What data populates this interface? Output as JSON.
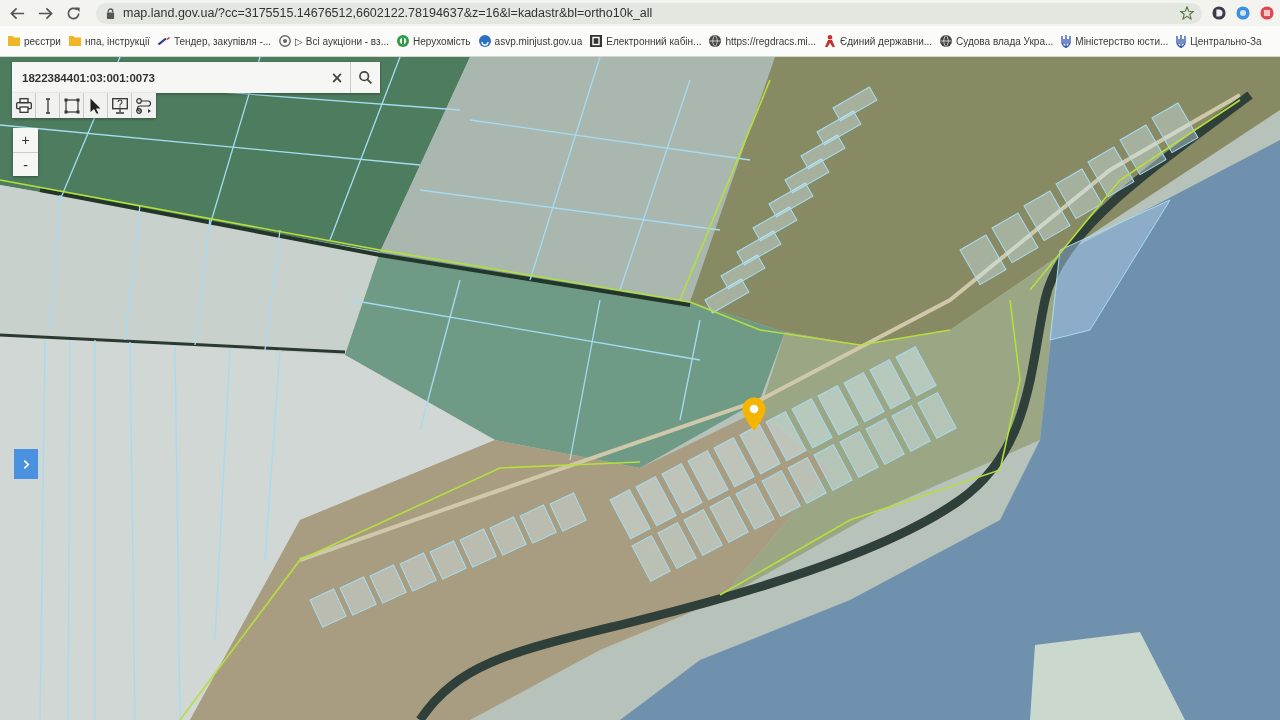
{
  "browser": {
    "url": "map.land.gov.ua/?cc=3175515.14676512,6602122.78194637&z=16&l=kadastr&bl=ortho10k_all"
  },
  "bookmarks": [
    {
      "kind": "folder",
      "label": "реєстри"
    },
    {
      "kind": "folder",
      "label": "нпа, інструкції"
    },
    {
      "kind": "pen",
      "label": "Тендер, закупівля -..."
    },
    {
      "kind": "ring",
      "label": "▷ Всі аукціони - вз..."
    },
    {
      "kind": "emblem",
      "label": "Нерухомість"
    },
    {
      "kind": "disc",
      "label": "asvp.minjust.gov.ua"
    },
    {
      "kind": "tile",
      "label": "Електронний кабін..."
    },
    {
      "kind": "globe",
      "label": "https://regdracs.mi..."
    },
    {
      "kind": "person",
      "label": "Єдиний державни..."
    },
    {
      "kind": "globe",
      "label": "Судова влада Укра..."
    },
    {
      "kind": "trident",
      "label": "Міністерство юсти..."
    },
    {
      "kind": "trident",
      "label": "Центрально-За"
    }
  ],
  "map": {
    "search": {
      "value": "1822384401:03:001:0073",
      "clear": "×"
    },
    "tools": [
      {
        "kind": "print"
      },
      {
        "kind": "measure-distance"
      },
      {
        "kind": "measure-area"
      },
      {
        "kind": "select"
      },
      {
        "kind": "help"
      },
      {
        "kind": "route"
      }
    ],
    "zoom": {
      "in": "+",
      "out": "-"
    }
  }
}
